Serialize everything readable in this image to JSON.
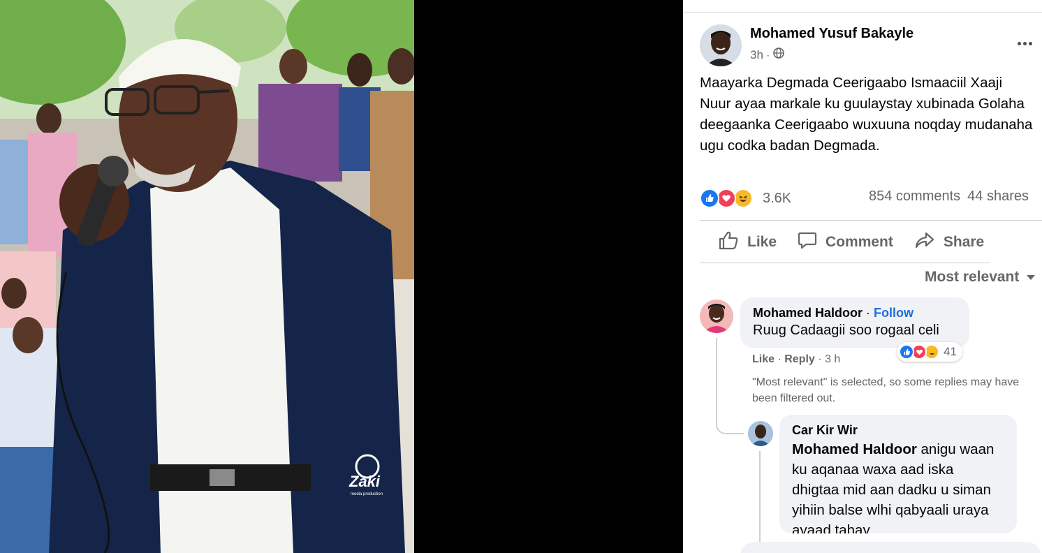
{
  "photo": {
    "watermark": "Zaki",
    "watermark_sub": "media production"
  },
  "post": {
    "author": "Mohamed Yusuf Bakayle",
    "time": "3h",
    "privacy_icon": "globe-icon",
    "text": "Maayarka Degmada Ceerigaabo Ismaaciil Xaaji Nuur ayaa markale ku guulaystay xubinada Golaha deegaanka Ceerigaabo wuxuuna noqday mudanaha ugu codka badan Degmada.",
    "reaction_count": "3.6K",
    "reactions": [
      "like-reaction",
      "love-reaction",
      "haha-reaction"
    ],
    "comments_count": "854 comments",
    "shares_count": "44 shares"
  },
  "actions": {
    "like": "Like",
    "comment": "Comment",
    "share": "Share"
  },
  "sort": {
    "label": "Most relevant"
  },
  "comments": [
    {
      "name": "Mohamed Haldoor",
      "separator": "·",
      "follow": "Follow",
      "text": "Ruug Cadaagii soo rogaal celi",
      "reaction_count": "41",
      "like": "Like",
      "dot": "·",
      "reply": "Reply",
      "time": "3 h"
    },
    {
      "name": "Car Kir Wir",
      "mention": "Mohamed Haldoor",
      "text": " anigu waan ku aqanaa waxa aad iska dhigtaa mid aan dadku u siman yihiin balse wlhi qabyaali uraya ayaad tahay"
    }
  ],
  "filtered_notice": "\"Most relevant\" is selected, so some replies may have been filtered out.",
  "colors": {
    "link_blue": "#216fdb",
    "secondary_text": "#65676b",
    "bubble_bg": "#f0f2f5",
    "like_blue": "#1877f2",
    "love_red": "#f33e58",
    "haha_yellow": "#f7b928"
  }
}
